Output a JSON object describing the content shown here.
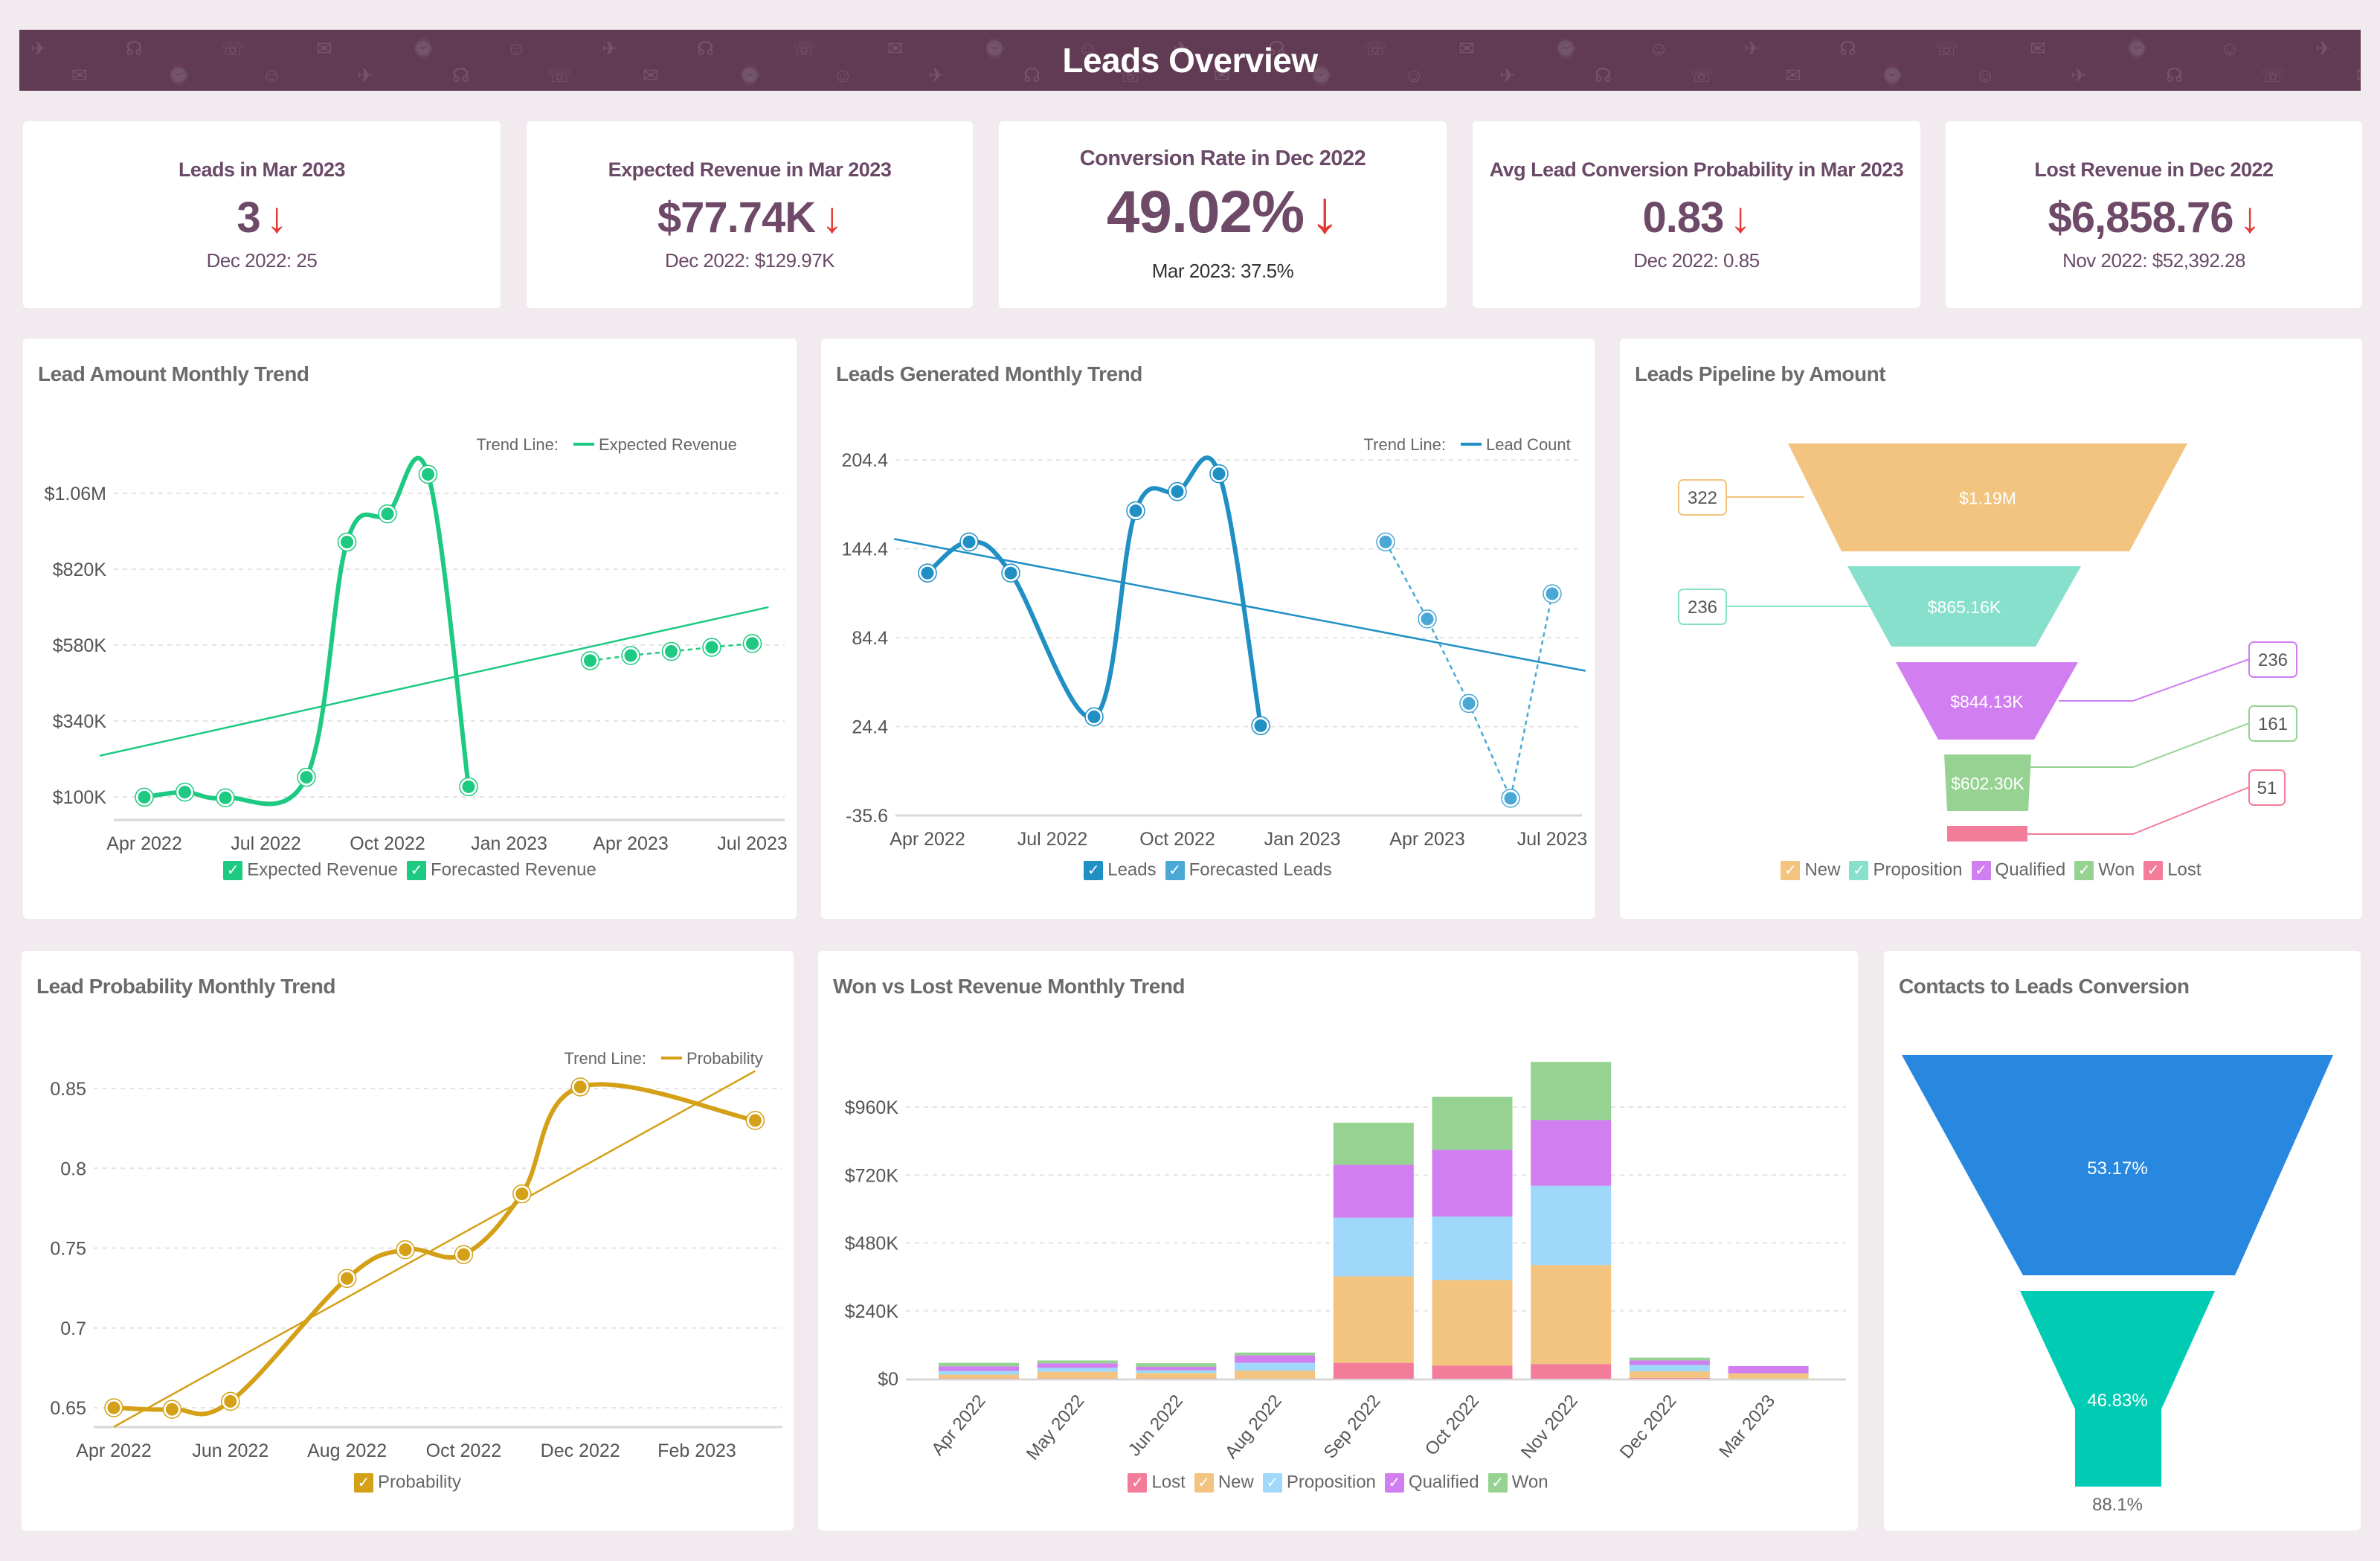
{
  "header": {
    "title": "Leads Overview",
    "background": "#613b54"
  },
  "kpis": [
    {
      "title": "Leads in Mar 2023",
      "value": "3",
      "trend": "down",
      "arrow": "↓",
      "comparison": "Dec 2022: 25"
    },
    {
      "title": "Expected Revenue in Mar 2023",
      "value": "$77.74K",
      "trend": "down",
      "arrow": "↓",
      "comparison": "Dec 2022: $129.97K"
    },
    {
      "title": "Conversion Rate in Dec 2022",
      "value": "49.02%",
      "trend": "down",
      "arrow": "↓",
      "comparison": "Mar 2023: 37.5%"
    },
    {
      "title": "Avg Lead Conversion Probability in Mar 2023",
      "value": "0.83",
      "trend": "down",
      "arrow": "↓",
      "comparison": "Dec 2022: 0.85"
    },
    {
      "title": "Lost Revenue in Dec 2022",
      "value": "$6,858.76",
      "trend": "down",
      "arrow": "↓",
      "comparison": "Nov 2022: $52,392.28"
    }
  ],
  "colors": {
    "down_arrow": "#e53935",
    "kpi_text": "#6f4a68"
  },
  "chart_data": [
    {
      "id": "lead_amount",
      "type": "line",
      "title": "Lead Amount Monthly Trend",
      "trend_line_label": "Trend Line:",
      "trend_line_series": "Expected Revenue",
      "yticks": [
        "$100K",
        "$340K",
        "$580K",
        "$820K",
        "$1.06M"
      ],
      "ytick_values": [
        100000,
        340000,
        580000,
        820000,
        1060000
      ],
      "xticks": [
        "Apr 2022",
        "Jul 2022",
        "Oct 2022",
        "Jan 2023",
        "Apr 2023",
        "Jul 2023"
      ],
      "xtick_months": [
        0,
        3,
        6,
        9,
        12,
        15
      ],
      "x_start": "Apr 2022",
      "series": [
        {
          "name": "Expected Revenue",
          "color": "#1ec981",
          "style": "solid",
          "points": [
            {
              "m": 0,
              "x": "Apr 2022",
              "y": 99000
            },
            {
              "m": 1,
              "x": "May 2022",
              "y": 115000
            },
            {
              "m": 2,
              "x": "Jun 2022",
              "y": 97000
            },
            {
              "m": 4,
              "x": "Aug 2022",
              "y": 162000
            },
            {
              "m": 5,
              "x": "Sep 2022",
              "y": 906000
            },
            {
              "m": 6,
              "x": "Oct 2022",
              "y": 995000
            },
            {
              "m": 7,
              "x": "Nov 2022",
              "y": 1120000
            },
            {
              "m": 8,
              "x": "Dec 2022",
              "y": 132000
            }
          ]
        },
        {
          "name": "Forecasted Revenue",
          "color": "#1ec981",
          "style": "dashed",
          "points": [
            {
              "m": 11,
              "x": "Mar 2023",
              "y": 531000
            },
            {
              "m": 12,
              "x": "Apr 2023",
              "y": 547000
            },
            {
              "m": 13,
              "x": "May 2023",
              "y": 560000
            },
            {
              "m": 14,
              "x": "Jun 2023",
              "y": 573000
            },
            {
              "m": 15,
              "x": "Jul 2023",
              "y": 585000
            }
          ]
        }
      ],
      "trend_line": {
        "start": {
          "m": -1.1,
          "y": 230000
        },
        "end": {
          "m": 15.4,
          "y": 700000
        }
      },
      "legend": [
        {
          "label": "Expected Revenue",
          "color": "#1ec981"
        },
        {
          "label": "Forecasted Revenue",
          "color": "#1ec981"
        }
      ]
    },
    {
      "id": "leads_generated",
      "type": "line",
      "title": "Leads Generated Monthly Trend",
      "trend_line_label": "Trend Line:",
      "trend_line_series": "Lead Count",
      "yticks": [
        "-35.6",
        "24.4",
        "84.4",
        "144.4",
        "204.4"
      ],
      "ytick_values": [
        -35.6,
        24.4,
        84.4,
        144.4,
        204.4
      ],
      "xticks": [
        "Apr 2022",
        "Jul 2022",
        "Oct 2022",
        "Jan 2023",
        "Apr 2023",
        "Jul 2023"
      ],
      "xtick_months": [
        0,
        3,
        6,
        9,
        12,
        15
      ],
      "series": [
        {
          "name": "Leads",
          "color": "#1f8fc4",
          "style": "solid",
          "points": [
            {
              "m": 0,
              "x": "Apr 2022",
              "y": 128
            },
            {
              "m": 1,
              "x": "May 2022",
              "y": 149
            },
            {
              "m": 2,
              "x": "Jun 2022",
              "y": 128
            },
            {
              "m": 4,
              "x": "Aug 2022",
              "y": 31
            },
            {
              "m": 5,
              "x": "Sep 2022",
              "y": 170
            },
            {
              "m": 6,
              "x": "Oct 2022",
              "y": 183
            },
            {
              "m": 7,
              "x": "Nov 2022",
              "y": 195
            },
            {
              "m": 8,
              "x": "Dec 2022",
              "y": 25
            }
          ]
        },
        {
          "name": "Forecasted Leads",
          "color": "#4aa8d6",
          "style": "dashed",
          "points": [
            {
              "m": 11,
              "x": "Mar 2023",
              "y": 149
            },
            {
              "m": 12,
              "x": "Apr 2023",
              "y": 97
            },
            {
              "m": 13,
              "x": "May 2023",
              "y": 40
            },
            {
              "m": 14,
              "x": "Jun 2023",
              "y": -24
            },
            {
              "m": 15,
              "x": "Jul 2023",
              "y": 114
            }
          ]
        }
      ],
      "trend_line": {
        "start": {
          "m": -0.8,
          "y": 151
        },
        "end": {
          "m": 15.8,
          "y": 62
        }
      },
      "legend": [
        {
          "label": "Leads",
          "color": "#1f8fc4"
        },
        {
          "label": "Forecasted Leads",
          "color": "#4aa8d6"
        }
      ]
    },
    {
      "id": "pipeline",
      "type": "funnel",
      "title": "Leads Pipeline by Amount",
      "stages": [
        {
          "name": "New",
          "amount": "$1.19M",
          "count": "322",
          "color": "#f2c47f",
          "label_side": "left"
        },
        {
          "name": "Proposition",
          "amount": "$865.16K",
          "count": "236",
          "color": "#87e0cb",
          "label_side": "left"
        },
        {
          "name": "Qualified",
          "amount": "$844.13K",
          "count": "236",
          "color": "#d07ef0",
          "label_side": "right"
        },
        {
          "name": "Won",
          "amount": "$602.30K",
          "count": "161",
          "color": "#96d392",
          "label_side": "right"
        },
        {
          "name": "Lost",
          "amount": "",
          "count": "51",
          "color": "#f37c9a",
          "label_side": "right"
        }
      ]
    },
    {
      "id": "lead_probability",
      "type": "line",
      "title": "Lead Probability Monthly Trend",
      "trend_line_label": "Trend Line:",
      "trend_line_series": "Probability",
      "yticks": [
        "0.65",
        "0.7",
        "0.75",
        "0.8",
        "0.85"
      ],
      "ytick_values": [
        0.65,
        0.7,
        0.75,
        0.8,
        0.85
      ],
      "xticks": [
        "Apr 2022",
        "Jun 2022",
        "Aug 2022",
        "Oct 2022",
        "Dec 2022",
        "Feb 2023"
      ],
      "xtick_months": [
        0,
        2,
        4,
        6,
        8,
        10
      ],
      "series": [
        {
          "name": "Probability",
          "color": "#d4a017",
          "style": "solid",
          "points": [
            {
              "m": 0,
              "x": "Apr 2022",
              "y": 0.65
            },
            {
              "m": 1,
              "x": "May 2022",
              "y": 0.649
            },
            {
              "m": 2,
              "x": "Jun 2022",
              "y": 0.654
            },
            {
              "m": 4,
              "x": "Aug 2022",
              "y": 0.731
            },
            {
              "m": 5,
              "x": "Sep 2022",
              "y": 0.749
            },
            {
              "m": 6,
              "x": "Oct 2022",
              "y": 0.746
            },
            {
              "m": 7,
              "x": "Nov 2022",
              "y": 0.784
            },
            {
              "m": 8,
              "x": "Dec 2022",
              "y": 0.851
            },
            {
              "m": 11,
              "x": "Mar 2023",
              "y": 0.83
            }
          ]
        }
      ],
      "trend_line": {
        "start": {
          "m": 0,
          "y": 0.638
        },
        "end": {
          "m": 11,
          "y": 0.861
        }
      },
      "legend": [
        {
          "label": "Probability",
          "color": "#d4a017"
        }
      ]
    },
    {
      "id": "won_vs_lost",
      "type": "bar",
      "stacked": true,
      "title": "Won vs Lost Revenue Monthly Trend",
      "categories": [
        "Apr 2022",
        "May 2022",
        "Jun 2022",
        "Aug 2022",
        "Sep 2022",
        "Oct 2022",
        "Nov 2022",
        "Dec 2022",
        "Mar 2023"
      ],
      "yticks": [
        "$0",
        "$240K",
        "$480K",
        "$720K",
        "$960K"
      ],
      "ytick_values": [
        0,
        240000,
        480000,
        720000,
        960000
      ],
      "series": [
        {
          "name": "Lost",
          "color": "#f37c9a",
          "values": [
            1500,
            1000,
            1500,
            0,
            56000,
            46000,
            52000,
            3000,
            0
          ]
        },
        {
          "name": "New",
          "color": "#f2c47f",
          "values": [
            13000,
            23600,
            18600,
            28700,
            306000,
            303000,
            350000,
            23000,
            19000
          ]
        },
        {
          "name": "Proposition",
          "color": "#9fd8fa",
          "values": [
            13000,
            14000,
            10000,
            27700,
            207000,
            224000,
            280000,
            22600,
            0
          ]
        },
        {
          "name": "Qualified",
          "color": "#d07ef0",
          "values": [
            16600,
            16000,
            12000,
            26000,
            187000,
            236000,
            232000,
            16000,
            26000
          ]
        },
        {
          "name": "Won",
          "color": "#96d392",
          "values": [
            12000,
            10000,
            12600,
            10000,
            149000,
            188000,
            206000,
            10000,
            0
          ]
        }
      ]
    },
    {
      "id": "contacts_conversion",
      "type": "funnel",
      "title": "Contacts to Leads Conversion",
      "stages": [
        {
          "name": "Contacts",
          "label": "53.17%",
          "color": "#2888e0"
        },
        {
          "name": "Leads",
          "label": "46.83%",
          "color": "#00ccb4"
        }
      ],
      "conversion_label": "88.1%"
    }
  ]
}
